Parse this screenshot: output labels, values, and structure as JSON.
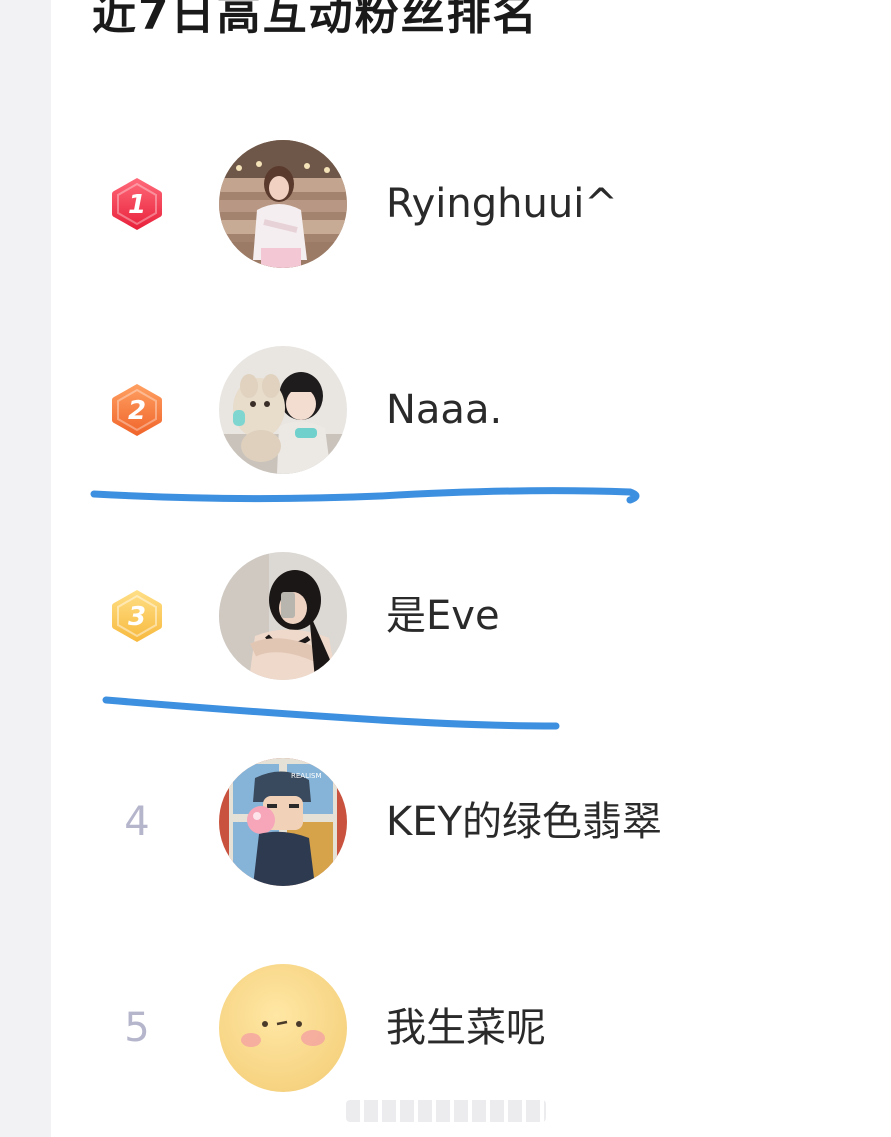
{
  "header": {
    "title": "近7日高互动粉丝排名"
  },
  "fans": [
    {
      "rank": "1",
      "name": "Ryinghuui^",
      "badge": "hexagon",
      "badge_color": "#f0344e",
      "avatar": "photo-girl-stairs"
    },
    {
      "rank": "2",
      "name": "Naaa.",
      "badge": "hexagon",
      "badge_color": "#f47a3a",
      "avatar": "photo-girl-teddy-bear"
    },
    {
      "rank": "3",
      "name": "是Eve",
      "badge": "hexagon",
      "badge_color": "#f8c24e",
      "avatar": "photo-girl-mirror-selfie"
    },
    {
      "rank": "4",
      "name": "KEY的绿色翡翠",
      "badge": "plain",
      "avatar": "cartoon-boy-bubble-gum"
    },
    {
      "rank": "5",
      "name": "我生菜呢",
      "badge": "plain",
      "avatar": "blushing-face-emoji"
    }
  ],
  "colors": {
    "rank_plain": "#b5b5cc",
    "annotation_stroke": "#3d8fe0",
    "page_bg": "#f2f2f4",
    "card_bg": "#ffffff"
  }
}
